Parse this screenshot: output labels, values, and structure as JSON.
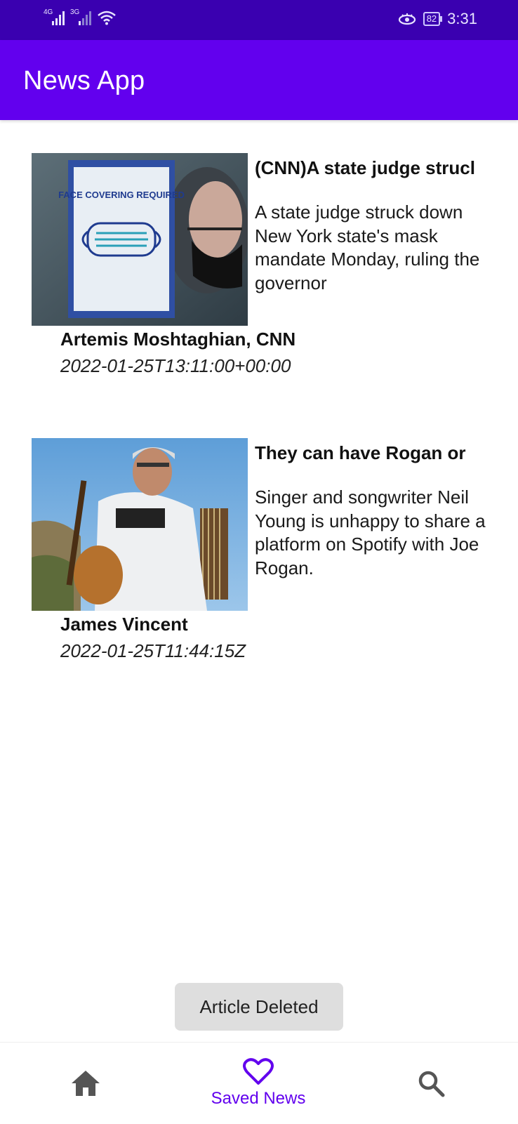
{
  "status_bar": {
    "net1": "4G",
    "net2": "3G",
    "battery": "82",
    "time": "3:31"
  },
  "app_bar": {
    "title": "News App"
  },
  "articles": [
    {
      "title": "(CNN)A state judge strucl",
      "description": "A state judge struck down New York state's mask mandate Monday, ruling the governor",
      "source": "Artemis Moshtaghian, CNN",
      "date": "2022-01-25T13:11:00+00:00",
      "image_text": "FACE COVERING REQUIRED"
    },
    {
      "title": "They can have Rogan or",
      "description": "Singer and songwriter Neil Young is unhappy to share a platform on Spotify with Joe Rogan.",
      "source": "James Vincent",
      "date": "2022-01-25T11:44:15Z"
    }
  ],
  "toast": {
    "text": "Article Deleted"
  },
  "bottom_nav": {
    "saved_label": "Saved News",
    "icons": [
      "home-icon",
      "heart-icon",
      "search-icon"
    ],
    "active_color": "#6200ee",
    "inactive_color": "#555555"
  },
  "colors": {
    "status_bar": "#3a00b0",
    "app_bar": "#6200ee"
  }
}
